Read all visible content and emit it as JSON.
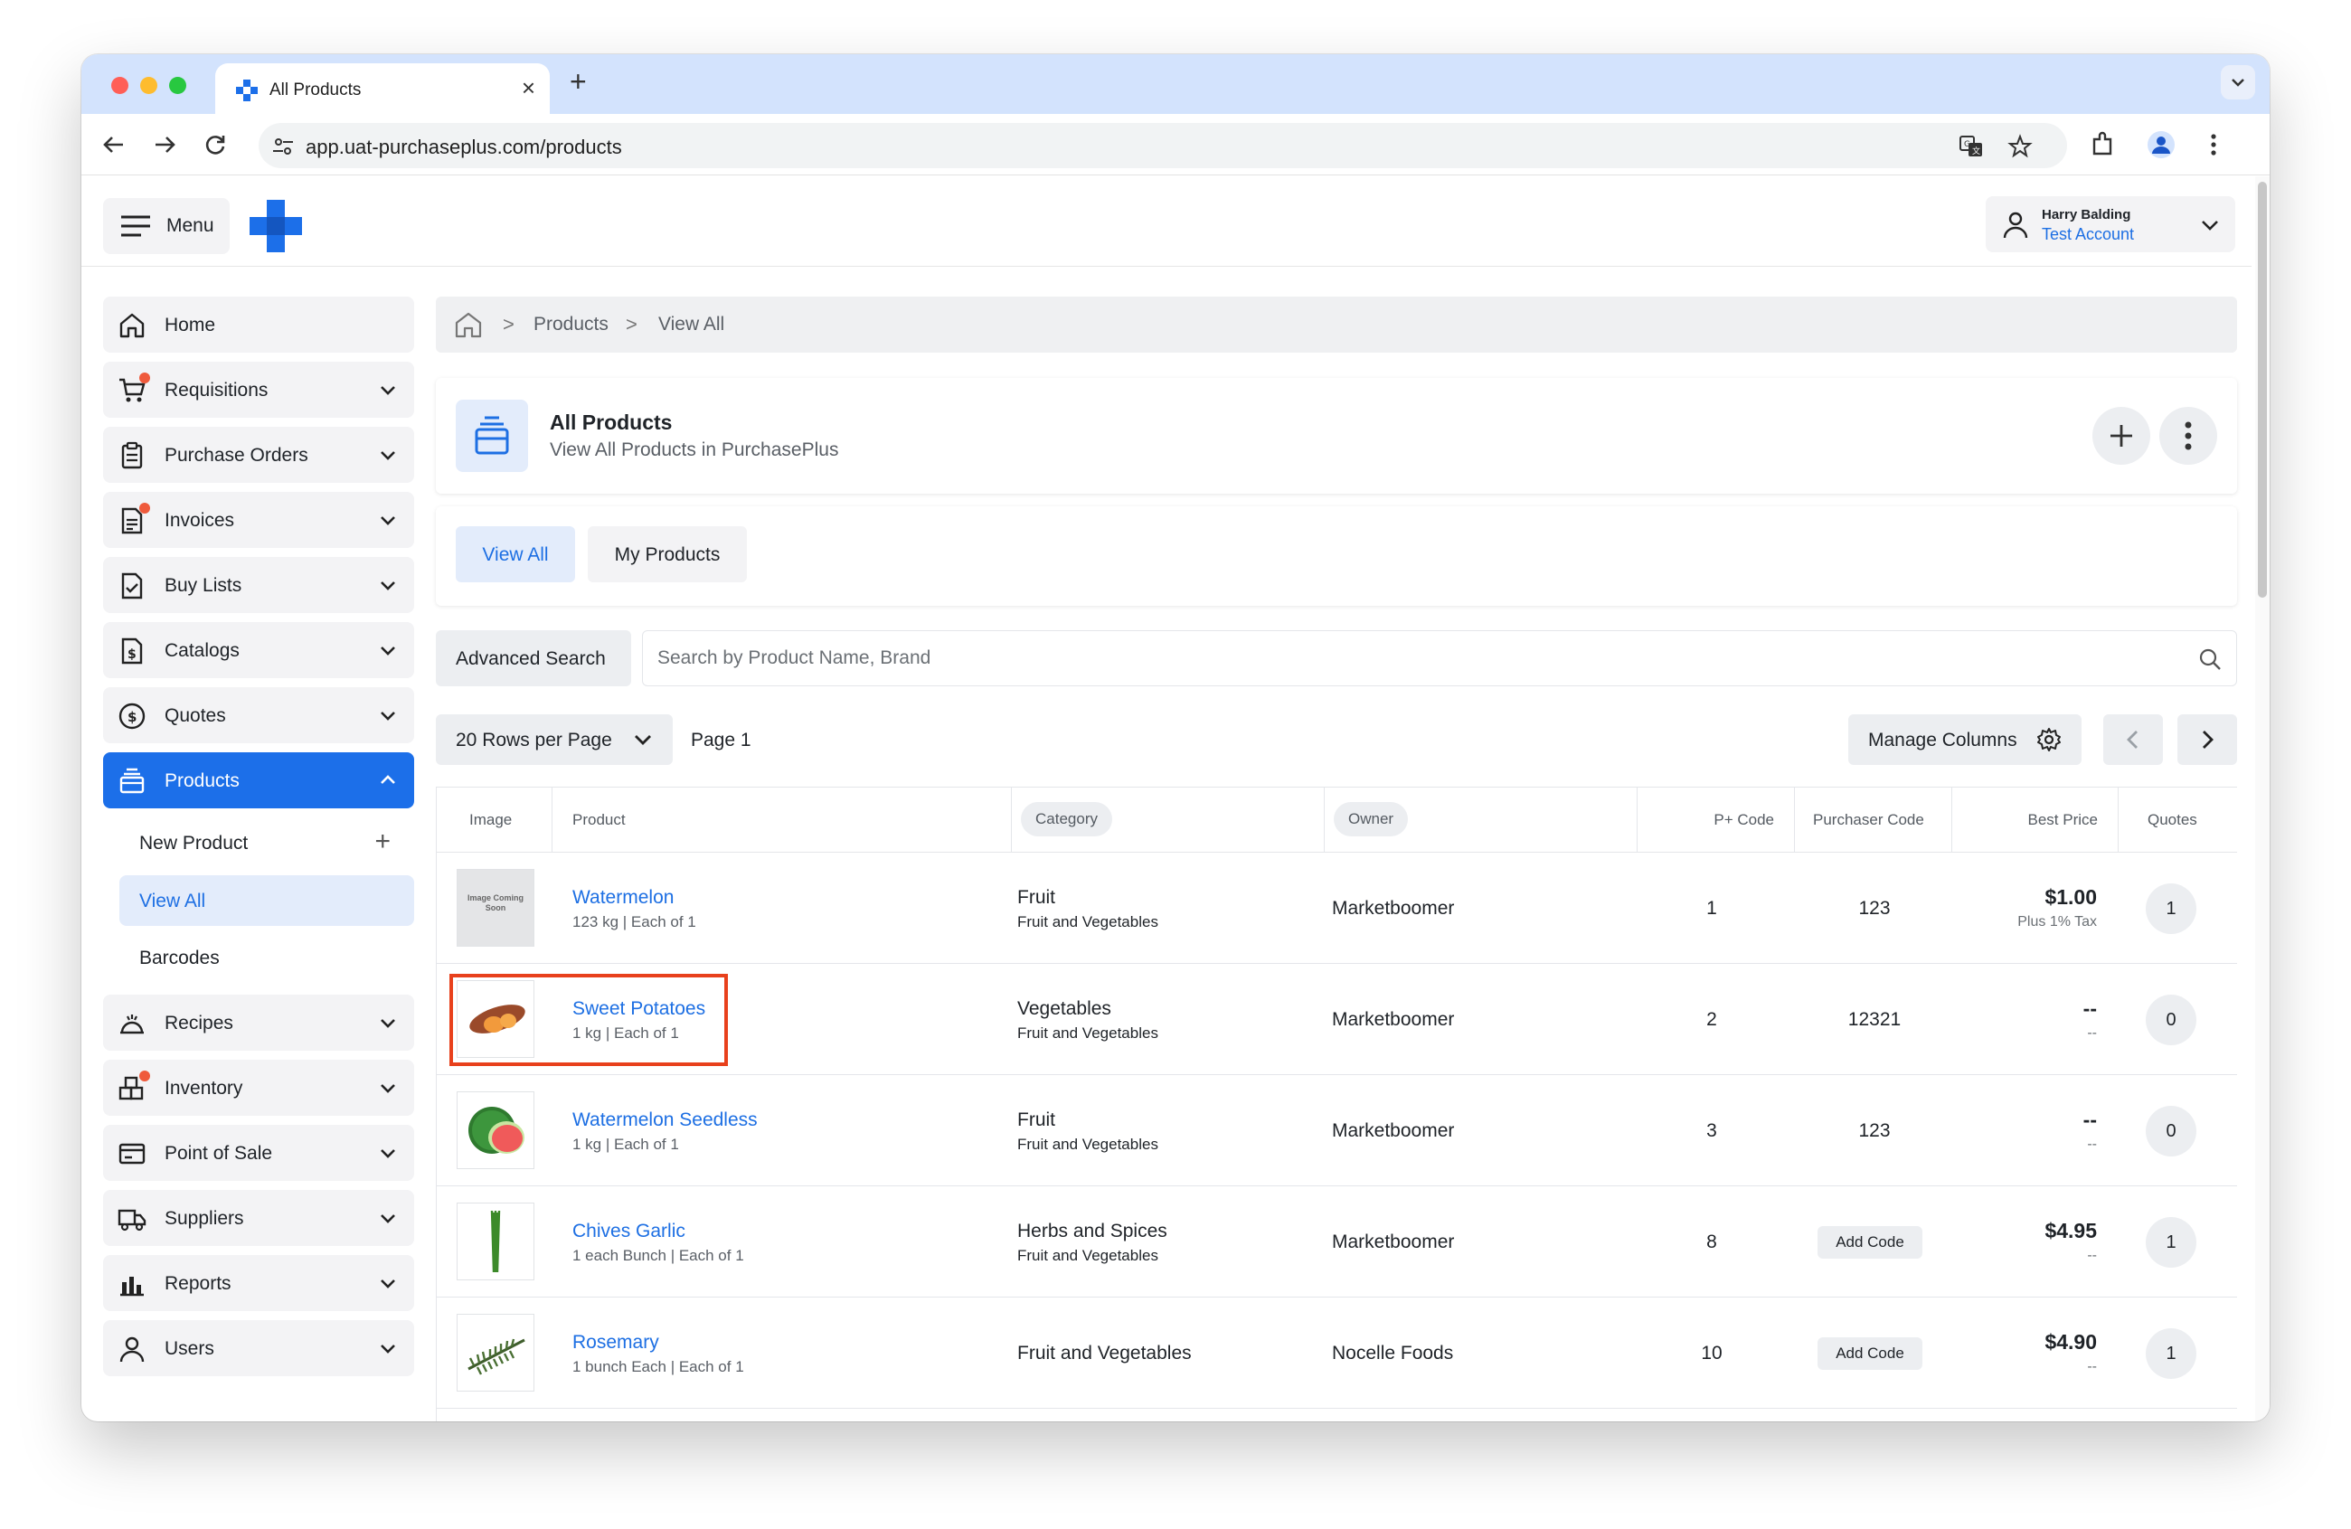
{
  "browser": {
    "tab_title": "All Products",
    "new_tab": "+",
    "close": "×",
    "url": "app.uat-purchaseplus.com/products"
  },
  "header": {
    "menu_label": "Menu",
    "user_name": "Harry Balding",
    "account": "Test Account"
  },
  "sidebar": {
    "items": [
      {
        "label": "Home",
        "icon": "home-icon"
      },
      {
        "label": "Requisitions",
        "icon": "cart-icon"
      },
      {
        "label": "Purchase Orders",
        "icon": "clipboard-icon"
      },
      {
        "label": "Invoices",
        "icon": "invoice-icon"
      },
      {
        "label": "Buy Lists",
        "icon": "checklist-icon"
      },
      {
        "label": "Catalogs",
        "icon": "catalog-icon"
      },
      {
        "label": "Quotes",
        "icon": "dollar-icon"
      },
      {
        "label": "Products",
        "icon": "products-icon"
      },
      {
        "label": "Recipes",
        "icon": "recipe-icon"
      },
      {
        "label": "Inventory",
        "icon": "inventory-icon"
      },
      {
        "label": "Point of Sale",
        "icon": "pos-icon"
      },
      {
        "label": "Suppliers",
        "icon": "truck-icon"
      },
      {
        "label": "Reports",
        "icon": "reports-icon"
      },
      {
        "label": "Users",
        "icon": "user-icon"
      }
    ],
    "products_sub": [
      "New Product",
      "View All",
      "Barcodes"
    ]
  },
  "breadcrumb": {
    "products": "Products",
    "view_all": "View All"
  },
  "page": {
    "title": "All Products",
    "subtitle": "View All Products in PurchasePlus"
  },
  "tabs": {
    "view_all": "View All",
    "my_products": "My Products"
  },
  "search": {
    "advanced": "Advanced Search",
    "placeholder": "Search by Product Name, Brand"
  },
  "pagination": {
    "rows_per_page": "20 Rows per Page",
    "page": "Page 1",
    "manage_columns": "Manage Columns"
  },
  "table": {
    "headers": {
      "image": "Image",
      "product": "Product",
      "category": "Category",
      "owner": "Owner",
      "p_code": "P+ Code",
      "purchaser_code": "Purchaser Code",
      "best_price": "Best Price",
      "quotes": "Quotes"
    },
    "rows": [
      {
        "name": "Watermelon",
        "detail": "123 kg | Each of 1",
        "category": "Fruit",
        "category_sub": "Fruit and Vegetables",
        "owner": "Marketboomer",
        "p_code": "1",
        "purchaser_code": "123",
        "price": "$1.00",
        "price_sub": "Plus 1% Tax",
        "quotes": "1",
        "image_text": "Image Coming Soon"
      },
      {
        "name": "Sweet Potatoes",
        "detail": "1 kg | Each of 1",
        "category": "Vegetables",
        "category_sub": "Fruit and Vegetables",
        "owner": "Marketboomer",
        "p_code": "2",
        "purchaser_code": "12321",
        "price": "--",
        "price_sub": "--",
        "quotes": "0"
      },
      {
        "name": "Watermelon Seedless",
        "detail": "1 kg | Each of 1",
        "category": "Fruit",
        "category_sub": "Fruit and Vegetables",
        "owner": "Marketboomer",
        "p_code": "3",
        "purchaser_code": "123",
        "price": "--",
        "price_sub": "--",
        "quotes": "0"
      },
      {
        "name": "Chives Garlic",
        "detail": "1 each Bunch | Each of 1",
        "category": "Herbs and Spices",
        "category_sub": "Fruit and Vegetables",
        "owner": "Marketboomer",
        "p_code": "8",
        "purchaser_code": "Add Code",
        "price": "$4.95",
        "price_sub": "--",
        "quotes": "1"
      },
      {
        "name": "Rosemary",
        "detail": "1 bunch Each | Each of 1",
        "category": "Fruit and Vegetables",
        "owner": "Nocelle Foods",
        "p_code": "10",
        "purchaser_code": "Add Code",
        "price": "$4.90",
        "price_sub": "--",
        "quotes": "1"
      }
    ]
  },
  "colors": {
    "accent": "#1c6fe9",
    "link": "#1d6fe3",
    "highlight": "#e8401c",
    "badge": "#ef5a3c"
  }
}
